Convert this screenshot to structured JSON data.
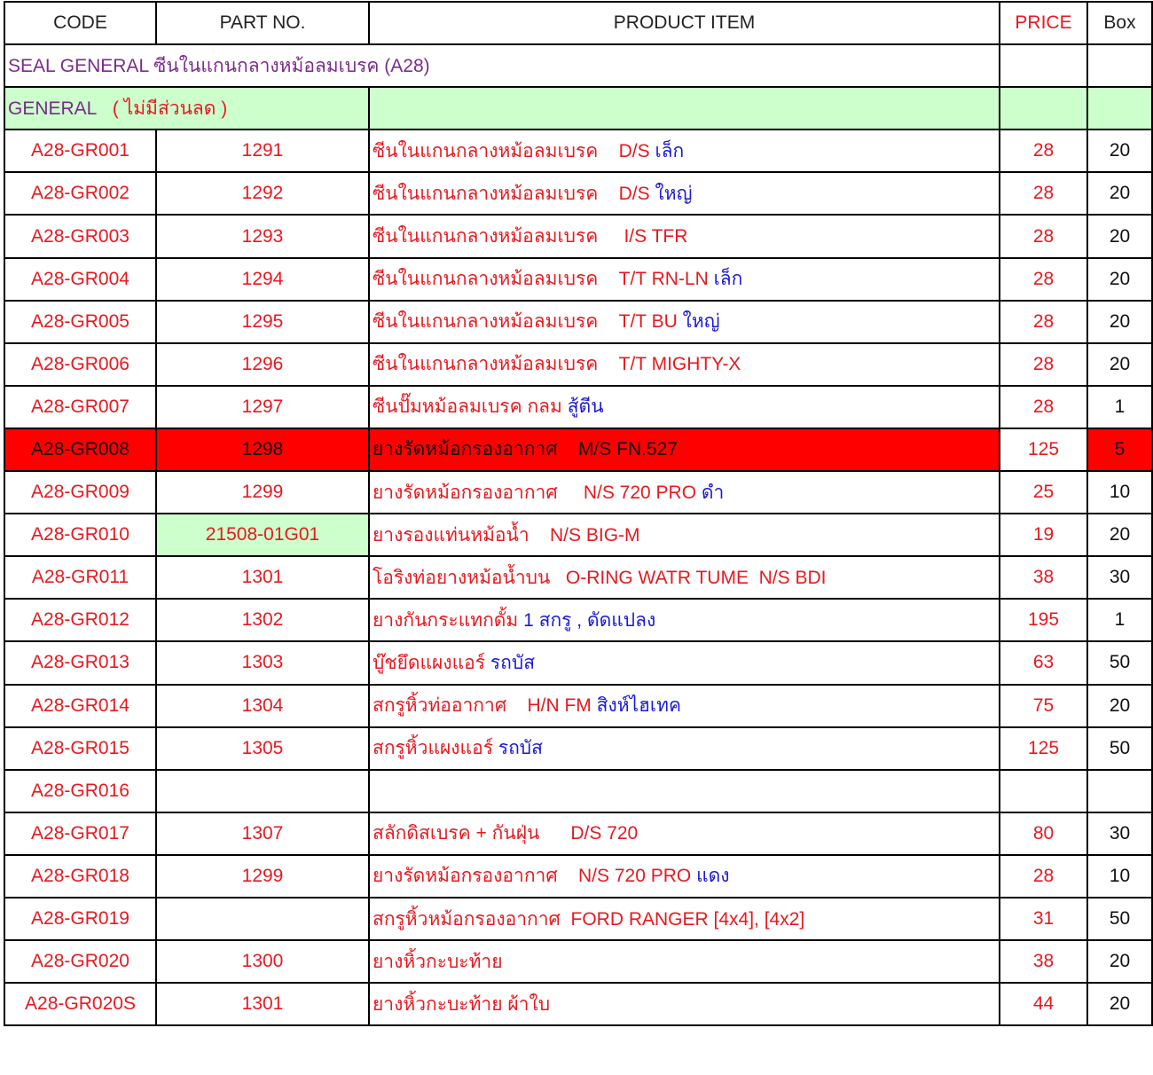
{
  "headers": {
    "code": "CODE",
    "part_no": "PART NO.",
    "product_item": "PRODUCT ITEM",
    "price": "PRICE",
    "box": "Box"
  },
  "title_row": "SEAL GENERAL ซีนในแกนกลางหม้อลมเบรค  (A28)",
  "section": {
    "label": "GENERAL",
    "note": "( ไม่มีส่วนลด )"
  },
  "colors": {
    "red_text": "#e8191f",
    "blue_text": "#1a1ad6",
    "purple_text": "#7b2a8c",
    "green_fill": "#ccffcc",
    "highlight_fill": "#ff0000"
  },
  "rows": [
    {
      "code": "A28-GR001",
      "part": "1291",
      "item_red": "ซีนในแกนกลางหม้อลมเบรค    D/S ",
      "item_blue": "เล็ก",
      "price": "28",
      "box": "20"
    },
    {
      "code": "A28-GR002",
      "part": "1292",
      "item_red": "ซีนในแกนกลางหม้อลมเบรค    D/S ",
      "item_blue": "ใหญ่",
      "price": "28",
      "box": "20"
    },
    {
      "code": "A28-GR003",
      "part": "1293",
      "item_red": "ซีนในแกนกลางหม้อลมเบรค     I/S TFR",
      "item_blue": "",
      "price": "28",
      "box": "20"
    },
    {
      "code": "A28-GR004",
      "part": "1294",
      "item_red": "ซีนในแกนกลางหม้อลมเบรค    T/T RN-LN ",
      "item_blue": "เล็ก",
      "price": "28",
      "box": "20"
    },
    {
      "code": "A28-GR005",
      "part": "1295",
      "item_red": "ซีนในแกนกลางหม้อลมเบรค    T/T BU ",
      "item_blue": "ใหญ่",
      "price": "28",
      "box": "20"
    },
    {
      "code": "A28-GR006",
      "part": "1296",
      "item_red": "ซีนในแกนกลางหม้อลมเบรค    T/T MIGHTY-X",
      "item_blue": "",
      "price": "28",
      "box": "20"
    },
    {
      "code": "A28-GR007",
      "part": "1297",
      "item_red": "ซีนปั๊มหม้อลมเบรค กลม ",
      "item_blue": "สู้ตีน",
      "price": "28",
      "box": "1"
    },
    {
      "code": "A28-GR008",
      "part": "1298",
      "item_red": "ยางรัดหม้อกรองอากาศ    M/S FN.527",
      "item_blue": "",
      "price": "125",
      "box": "5",
      "highlight": true
    },
    {
      "code": "A28-GR009",
      "part": "1299",
      "item_red": "ยางรัดหม้อกรองอากาศ     N/S 720 PRO ",
      "item_blue": "ดำ",
      "price": "25",
      "box": "10"
    },
    {
      "code": "A28-GR010",
      "part": "21508-01G01",
      "item_red": "ยางรองแท่นหม้อน้ำ    N/S BIG-M",
      "item_blue": "",
      "price": "19",
      "box": "20",
      "part_green": true
    },
    {
      "code": "A28-GR011",
      "part": "1301",
      "item_red": "โอริงท่อยางหม้อน้ำบน   O-RING WATR TUME  N/S BDI",
      "item_blue": "",
      "price": "38",
      "box": "30"
    },
    {
      "code": "A28-GR012",
      "part": "1302",
      "item_red": "ยางกันกระแทกดั้ม ",
      "item_blue": "1 สกรู , ดัดแปลง",
      "price": "195",
      "box": "1"
    },
    {
      "code": "A28-GR013",
      "part": "1303",
      "item_red": "บู๊ชยึดแผงแอร์ ",
      "item_blue": "รถบัส",
      "price": "63",
      "box": "50"
    },
    {
      "code": "A28-GR014",
      "part": "1304",
      "item_red": "สกรูหิ้วท่ออากาศ    H/N FM ",
      "item_blue": "สิงห์ไฮเทค",
      "price": "75",
      "box": "20"
    },
    {
      "code": "A28-GR015",
      "part": "1305",
      "item_red": "สกรูหิ้วแผงแอร์ ",
      "item_blue": "รถบัส",
      "price": "125",
      "box": "50"
    },
    {
      "code": "A28-GR016",
      "part": "",
      "item_red": "",
      "item_blue": "",
      "price": "",
      "box": ""
    },
    {
      "code": "A28-GR017",
      "part": "1307",
      "item_red": "สลักดิสเบรค + กันฝุ่น      D/S 720",
      "item_blue": "",
      "price": "80",
      "box": "30"
    },
    {
      "code": "A28-GR018",
      "part": "1299",
      "item_red": "ยางรัดหม้อกรองอากาศ    N/S 720 PRO ",
      "item_blue": "แดง",
      "price": "28",
      "box": "10"
    },
    {
      "code": "A28-GR019",
      "part": "",
      "item_red": "สกรูหิ้วหม้อกรองอากาศ  FORD RANGER [4x4], [4x2]",
      "item_blue": "",
      "price": "31",
      "box": "50"
    },
    {
      "code": "A28-GR020",
      "part": "1300",
      "item_red": "ยางหิ้วกะบะท้าย",
      "item_blue": "",
      "price": "38",
      "box": "20"
    },
    {
      "code": "A28-GR020S",
      "part": "1301",
      "item_red": "ยางหิ้วกะบะท้าย ผ้าใบ",
      "item_blue": "",
      "price": "44",
      "box": "20"
    }
  ]
}
